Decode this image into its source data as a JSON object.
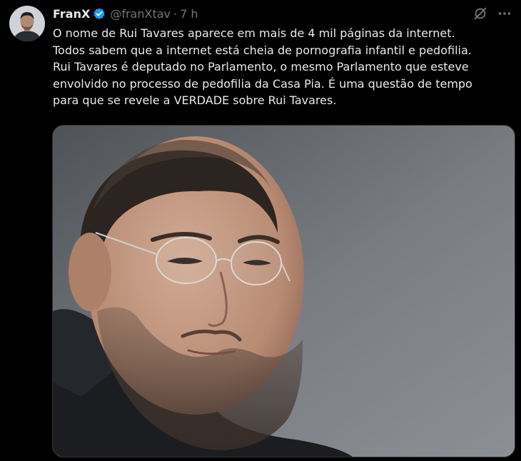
{
  "tweet": {
    "author": {
      "display_name": "FranX",
      "handle": "@franXtav",
      "verified": true,
      "avatar_icon": "profile-avatar"
    },
    "separator": "·",
    "time": "7 h",
    "text_lines": [
      "O nome de Rui Tavares aparece em mais de 4 mil páginas da internet.",
      "Todos sabem que a internet está cheia de pornografia infantil e pedofilia.",
      "Rui Tavares é deputado no Parlamento, o mesmo Parlamento que esteve",
      "envolvido no processo de pedofilia da Casa Pia. É uma questão de tempo",
      "para que se revele a VERDADE sobre Rui Tavares."
    ],
    "actions": {
      "grok_icon": "grok-icon",
      "more_icon": "more-options-icon"
    }
  },
  "colors": {
    "background": "#000000",
    "text_primary": "#e7e9ea",
    "text_secondary": "#71767b",
    "verified_blue": "#1d9bf0",
    "border": "#2f3336"
  }
}
